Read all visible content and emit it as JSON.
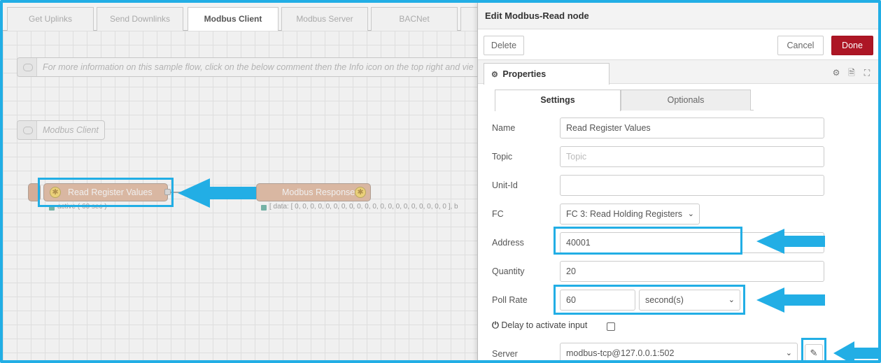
{
  "workspace": {
    "tabs": [
      "Get Uplinks",
      "Send Downlinks",
      "Modbus Client",
      "Modbus Server",
      "BACNet"
    ],
    "active_tab": "Modbus Client",
    "info_comment": "For more information on this sample flow, click on the below comment then the Info icon on the top right and vie",
    "section_comment": "Modbus Client",
    "read_node_label": "Read Register Values",
    "read_node_status": "active ( 60 sec )",
    "response_node_label": "Modbus Response",
    "response_node_status": "[ data: [ 0, 0, 0, 0, 0, 0, 0, 0, 0, 0, 0, 0, 0, 0, 0, 0, 0, 0, 0, 0 ], b",
    "node_icon_glyph": "✱"
  },
  "panel": {
    "title": "Edit Modbus-Read node",
    "delete_label": "Delete",
    "cancel_label": "Cancel",
    "done_label": "Done",
    "properties_label": "Properties",
    "properties_icon": "gear-icon",
    "subtabs": {
      "settings": "Settings",
      "optionals": "Optionals"
    },
    "fields": {
      "name": {
        "label": "Name",
        "value": "Read Register Values"
      },
      "topic": {
        "label": "Topic",
        "value": "",
        "placeholder": "Topic"
      },
      "unit_id": {
        "label": "Unit-Id",
        "value": ""
      },
      "fc": {
        "label": "FC",
        "value": "FC 3: Read Holding Registers"
      },
      "address": {
        "label": "Address",
        "value": "40001"
      },
      "quantity": {
        "label": "Quantity",
        "value": "20"
      },
      "poll_rate": {
        "label": "Poll Rate",
        "value": "60",
        "unit": "second(s)"
      },
      "delay": {
        "label": "Delay to activate input",
        "checked": false
      },
      "server": {
        "label": "Server",
        "value": "modbus-tcp@127.0.0.1:502"
      }
    }
  },
  "colors": {
    "highlight": "#22aee5",
    "node_fill": "#e0b094",
    "done_button": "#ad1625"
  }
}
